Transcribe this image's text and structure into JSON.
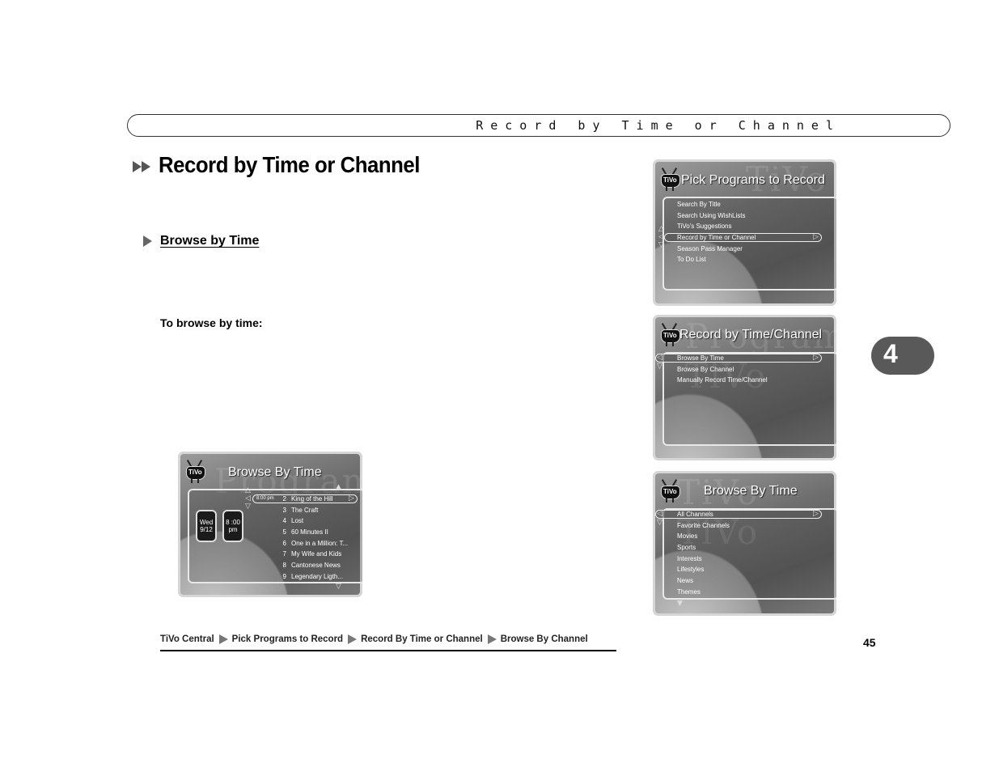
{
  "header": {
    "running_title": "Record by Time or Channel"
  },
  "section": {
    "title": "Record by Time or Channel",
    "subheading": "Browse by Time",
    "instruction": "To browse by time:"
  },
  "chapter_tab": {
    "number": "4",
    "color": "#595959"
  },
  "page_number": "45",
  "breadcrumb": [
    "TiVo Central",
    "Pick Programs to Record",
    "Record By Time or Channel",
    "Browse By Channel"
  ],
  "screens": {
    "pick_programs": {
      "logo": "TiVo",
      "title": "Pick Programs to Record",
      "watermark": "TiVo",
      "items": [
        "Search By Title",
        "Search Using WishLists",
        "TiVo's Suggestions",
        "Record by Time or Channel",
        "Season Pass Manager",
        "To Do List"
      ],
      "selected_index": 3
    },
    "record_by_time_channel": {
      "logo": "TiVo",
      "title": "Record by Time/Channel",
      "watermark": "Programs TiVo",
      "items": [
        "Browse By Time",
        "Browse By Channel",
        "Manually Record Time/Channel"
      ],
      "selected_index": 0
    },
    "browse_by_time_categories": {
      "logo": "TiVo",
      "title": "Browse By Time",
      "watermark": "TiVo TiVo",
      "items": [
        "All Channels",
        "Favorite Channels",
        "Movies",
        "Sports",
        "Interests",
        "Lifestyles",
        "News",
        "Themes"
      ],
      "selected_index": 0
    },
    "browse_by_time_grid": {
      "logo": "TiVo",
      "title": "Browse By Time",
      "watermark": "Programs",
      "date": {
        "day": "Wed",
        "date": "9/12"
      },
      "time": {
        "time": "8 :00",
        "ampm": "pm"
      },
      "selected_time": "8:00 pm",
      "rows": [
        {
          "channel": "2",
          "program": "King of the Hill"
        },
        {
          "channel": "3",
          "program": "The Craft"
        },
        {
          "channel": "4",
          "program": "Lost"
        },
        {
          "channel": "5",
          "program": "60 Minutes II"
        },
        {
          "channel": "6",
          "program": "One in a Million: T..."
        },
        {
          "channel": "7",
          "program": "My Wife and Kids"
        },
        {
          "channel": "8",
          "program": "Cantonese News"
        },
        {
          "channel": "9",
          "program": "Legendary Ligth..."
        }
      ]
    }
  }
}
